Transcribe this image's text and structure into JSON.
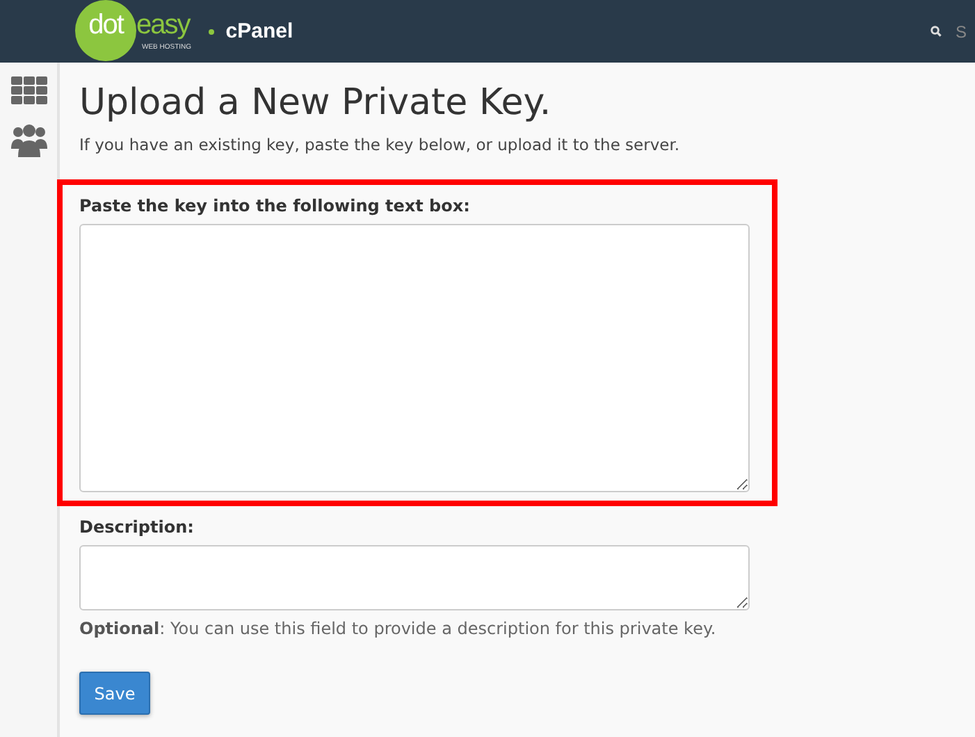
{
  "header": {
    "logo": {
      "first": "dot",
      "second": "easy",
      "tagline": "WEB HOSTING"
    },
    "product": "cPanel",
    "search": {
      "placeholder": "S"
    }
  },
  "sidebar": {
    "items": [
      {
        "kind": "grid"
      },
      {
        "kind": "users"
      }
    ]
  },
  "page": {
    "title": "Upload a New Private Key.",
    "intro": "If you have an existing key, paste the key below, or upload it to the server."
  },
  "form": {
    "key_label": "Paste the key into the following text box:",
    "key_highlighted": true,
    "description_label": "Description:",
    "description_help": "**Optional**: You can use this field to provide a description for this private key.",
    "button": "Save"
  }
}
